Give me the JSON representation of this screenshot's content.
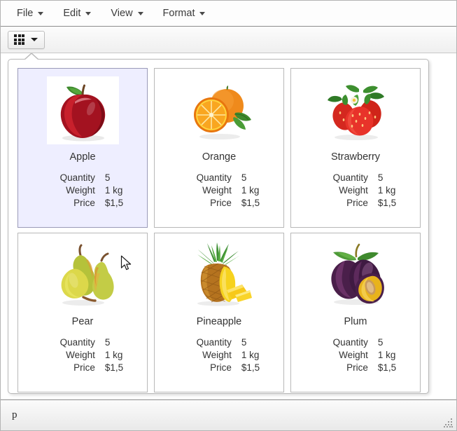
{
  "menubar": {
    "items": [
      {
        "label": "File",
        "icon": "chevron-down-icon"
      },
      {
        "label": "Edit",
        "icon": "chevron-down-icon"
      },
      {
        "label": "View",
        "icon": "chevron-down-icon"
      },
      {
        "label": "Format",
        "icon": "chevron-down-icon"
      }
    ]
  },
  "toolbar": {
    "grid_view_button": {
      "icon": "grid-icon",
      "dropdown_icon": "chevron-down-icon",
      "label": ""
    }
  },
  "panel": {
    "type": "popup-callout",
    "attrs": {
      "quantity_label": "Quantity",
      "weight_label": "Weight",
      "price_label": "Price"
    },
    "cards": [
      {
        "title": "Apple",
        "selected": true,
        "image": "apple-image",
        "quantity": "5",
        "weight": "1 kg",
        "price": "$1,5"
      },
      {
        "title": "Orange",
        "selected": false,
        "image": "orange-image",
        "quantity": "5",
        "weight": "1 kg",
        "price": "$1,5"
      },
      {
        "title": "Strawberry",
        "selected": false,
        "image": "strawberry-image",
        "quantity": "5",
        "weight": "1 kg",
        "price": "$1,5"
      },
      {
        "title": "Pear",
        "selected": false,
        "image": "pear-image",
        "quantity": "5",
        "weight": "1 kg",
        "price": "$1,5"
      },
      {
        "title": "Pineapple",
        "selected": false,
        "image": "pineapple-image",
        "quantity": "5",
        "weight": "1 kg",
        "price": "$1,5"
      },
      {
        "title": "Plum",
        "selected": false,
        "image": "plum-image",
        "quantity": "5",
        "weight": "1 kg",
        "price": "$1,5"
      }
    ]
  },
  "statusbar": {
    "text": "p",
    "resize_grip_icon": "resize-grip-icon"
  },
  "colors": {
    "selected_card_background": "#eeeeff",
    "selected_card_border": "#9a9ab8",
    "card_border": "#b8b8b8",
    "window_border": "#b4b4b4",
    "text": "#333333"
  }
}
